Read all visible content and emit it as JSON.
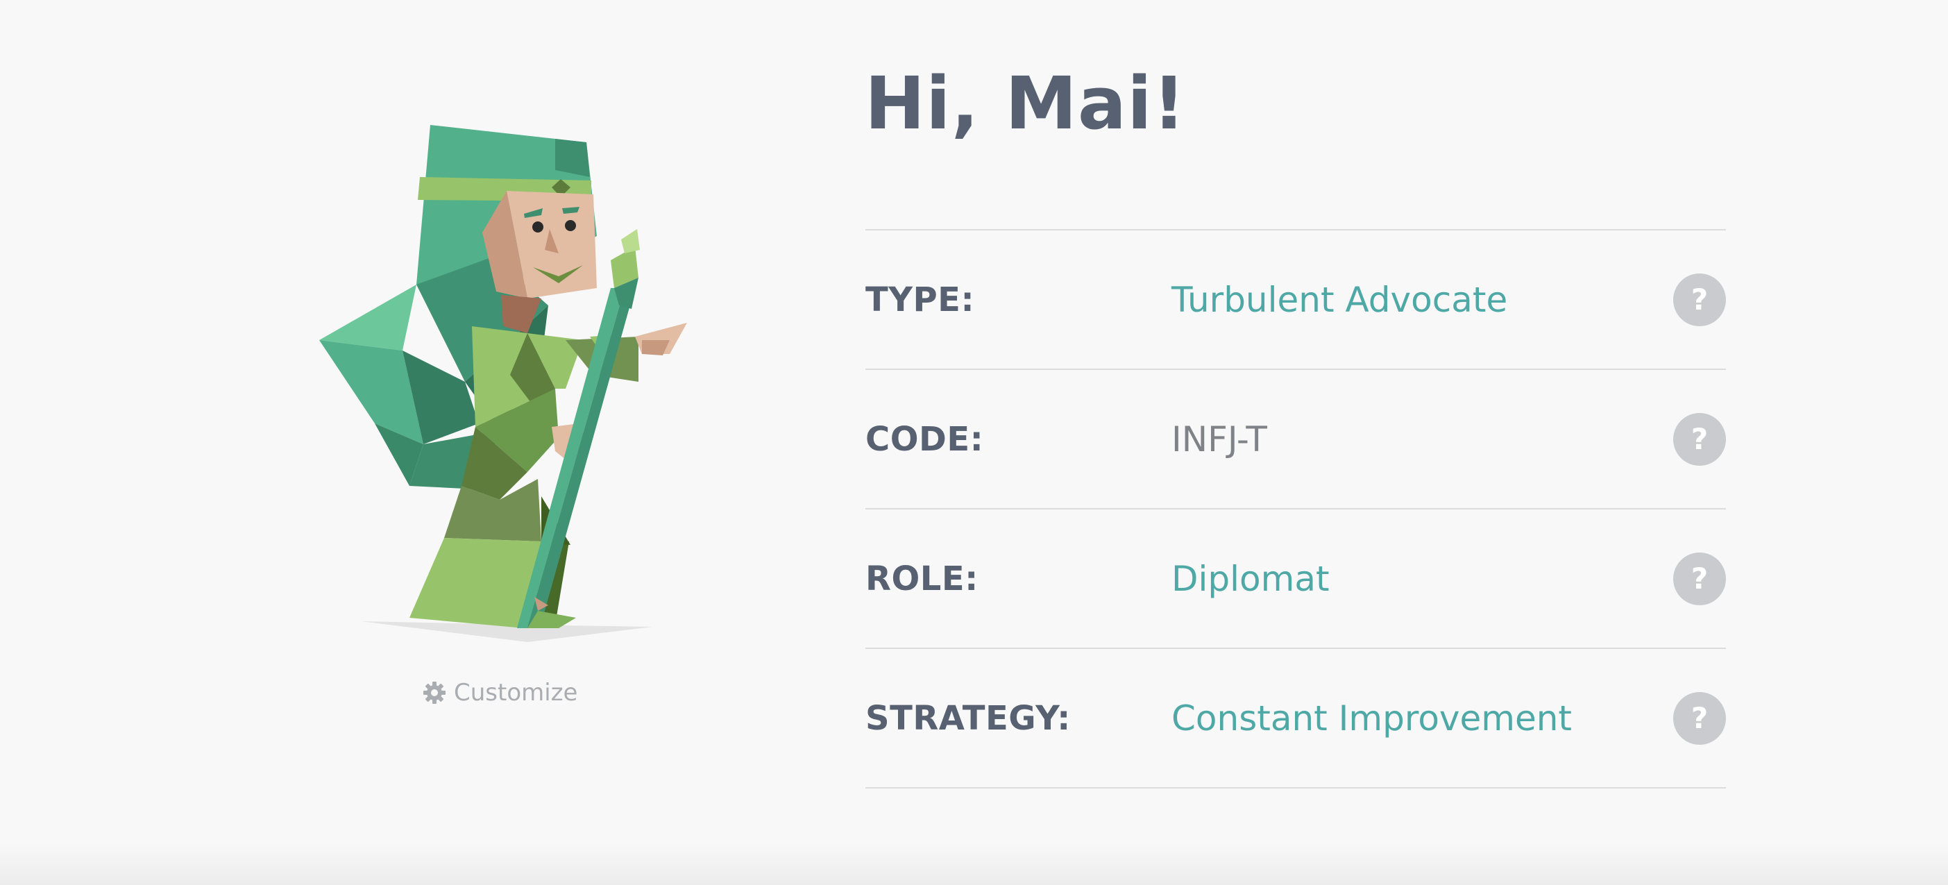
{
  "greeting": "Hi, Mai!",
  "avatar": {
    "customize_label": "Customize",
    "customize_icon": "gear-icon"
  },
  "profile": {
    "rows": [
      {
        "label": "TYPE:",
        "value": "Turbulent Advocate",
        "value_style": "accent"
      },
      {
        "label": "CODE:",
        "value": "INFJ-T",
        "value_style": "plain"
      },
      {
        "label": "ROLE:",
        "value": "Diplomat",
        "value_style": "accent"
      },
      {
        "label": "STRATEGY:",
        "value": "Constant Improvement",
        "value_style": "accent"
      }
    ],
    "help_label": "?"
  },
  "colors": {
    "background": "#f8f8f8",
    "heading": "#576171",
    "accent": "#4ea8a6",
    "plain_value": "#7f8388",
    "help_button": "#c9cbcf",
    "divider": "#dcdcdc"
  }
}
